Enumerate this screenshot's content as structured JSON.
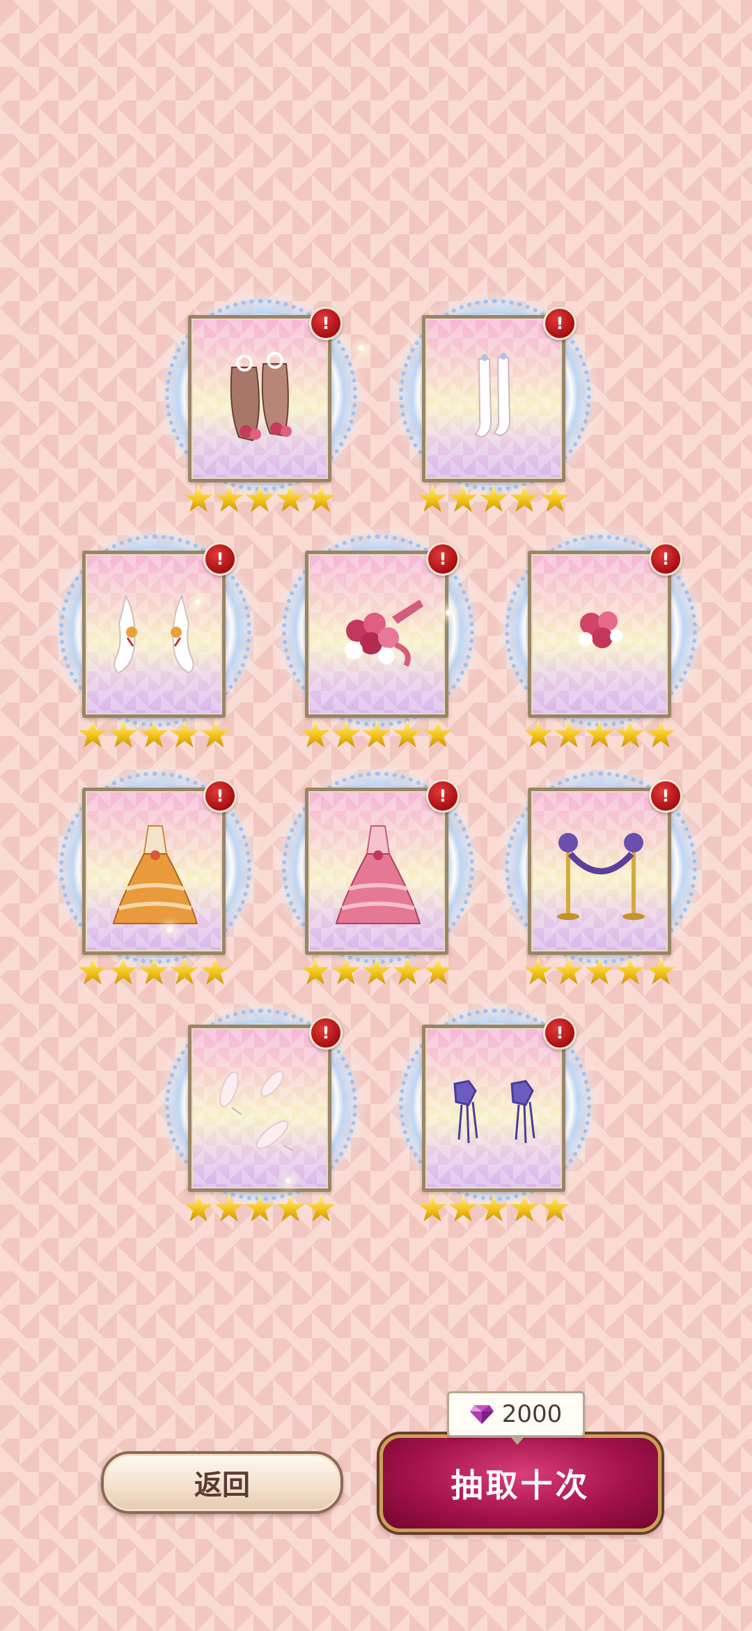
{
  "cards": [
    {
      "name": "card-shoes",
      "stars": 5,
      "badge": "!",
      "item": "shoes-icon"
    },
    {
      "name": "card-stockings",
      "stars": 5,
      "badge": "!",
      "item": "stockings-icon"
    },
    {
      "name": "card-gloves",
      "stars": 5,
      "badge": "!",
      "item": "gloves-icon"
    },
    {
      "name": "card-bouquet",
      "stars": 5,
      "badge": "!",
      "item": "bouquet-icon"
    },
    {
      "name": "card-rose-corsage",
      "stars": 5,
      "badge": "!",
      "item": "rose-corsage-icon"
    },
    {
      "name": "card-orange-gown",
      "stars": 5,
      "badge": "!",
      "item": "orange-gown-icon"
    },
    {
      "name": "card-pink-gown",
      "stars": 5,
      "badge": "!",
      "item": "pink-gown-icon"
    },
    {
      "name": "card-rope-barrier",
      "stars": 5,
      "badge": "!",
      "item": "rope-barrier-icon"
    },
    {
      "name": "card-feathers",
      "stars": 5,
      "badge": "!",
      "item": "feathers-icon"
    },
    {
      "name": "card-ribbon-earrings",
      "stars": 5,
      "badge": "!",
      "item": "ribbon-earrings-icon"
    }
  ],
  "buttons": {
    "back": "返回",
    "draw": "抽取十次"
  },
  "cost": {
    "amount": "2000",
    "icon": "gem-icon"
  },
  "colors": {
    "draw_button": "#a5124c",
    "frame": "#9a8467",
    "badge": "#c01a1f",
    "star": "#f4c417"
  }
}
